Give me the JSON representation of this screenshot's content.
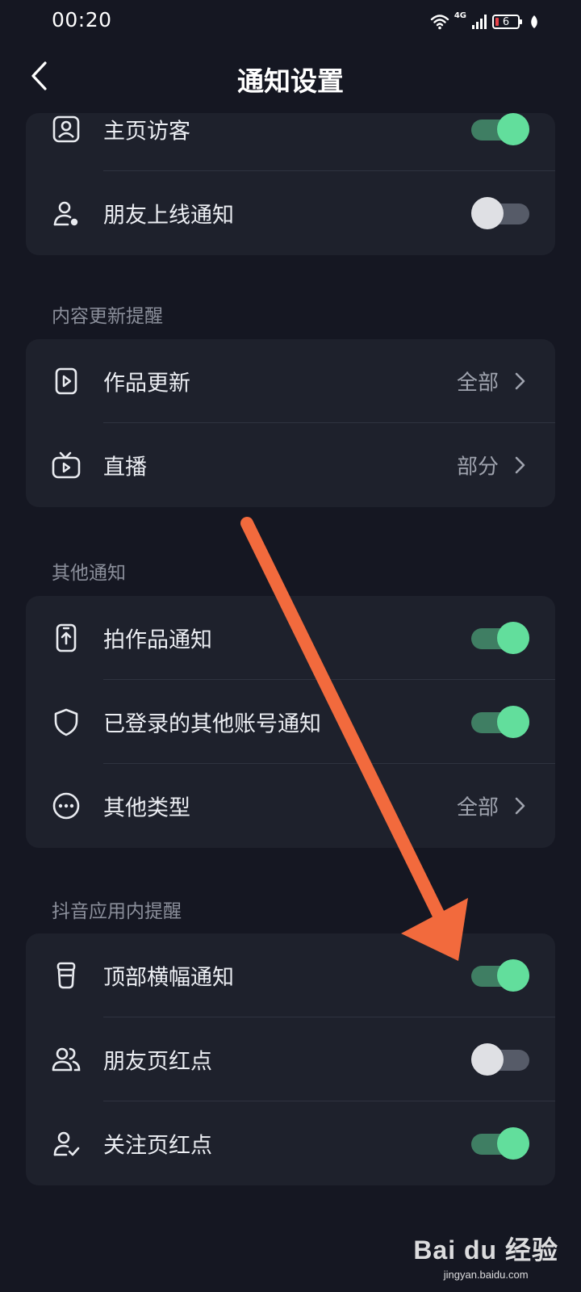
{
  "status_bar": {
    "time": "00:20",
    "network": "4G",
    "battery": "6"
  },
  "header": {
    "title": "通知设置",
    "back_icon": "chevron-left-icon"
  },
  "sections": {
    "top_card": [
      {
        "label": "主页访客",
        "icon": "person-card-icon",
        "type": "toggle",
        "state": "on"
      },
      {
        "label": "朋友上线通知",
        "icon": "person-online-icon",
        "type": "toggle",
        "state": "off"
      }
    ],
    "content_updates": {
      "title": "内容更新提醒",
      "items": [
        {
          "label": "作品更新",
          "icon": "video-file-icon",
          "type": "select",
          "value": "全部"
        },
        {
          "label": "直播",
          "icon": "tv-icon",
          "type": "select",
          "value": "部分"
        }
      ]
    },
    "other": {
      "title": "其他通知",
      "items": [
        {
          "label": "拍作品通知",
          "icon": "phone-upload-icon",
          "type": "toggle",
          "state": "on"
        },
        {
          "label": "已登录的其他账号通知",
          "icon": "shield-icon",
          "type": "toggle",
          "state": "on"
        },
        {
          "label": "其他类型",
          "icon": "more-circle-icon",
          "type": "select",
          "value": "全部"
        }
      ]
    },
    "in_app": {
      "title": "抖音应用内提醒",
      "items": [
        {
          "label": "顶部横幅通知",
          "icon": "banner-cup-icon",
          "type": "toggle",
          "state": "on"
        },
        {
          "label": "朋友页红点",
          "icon": "friends-icon",
          "type": "toggle",
          "state": "off"
        },
        {
          "label": "关注页红点",
          "icon": "person-check-icon",
          "type": "toggle",
          "state": "on"
        }
      ]
    }
  },
  "annotation": {
    "arrow_color": "#F26A3D"
  },
  "watermark": {
    "logo": "Bai du 经验",
    "text": "jingyan.baidu.com"
  },
  "colors": {
    "background": "#151722",
    "card": "#1E212C",
    "toggle_on": "#62DE9C",
    "toggle_off": "#DFE0E4"
  }
}
